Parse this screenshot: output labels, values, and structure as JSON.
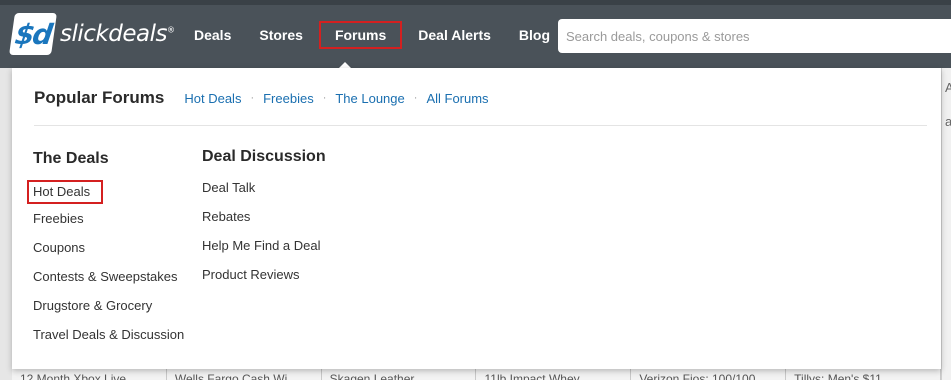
{
  "header": {
    "logo_mark": "$d",
    "logo_text": "slickdeals",
    "logo_reg": "®",
    "nav": [
      {
        "label": "Deals"
      },
      {
        "label": "Stores"
      },
      {
        "label": "Forums"
      },
      {
        "label": "Deal Alerts"
      },
      {
        "label": "Blog"
      }
    ],
    "search_placeholder": "Search deals, coupons & stores"
  },
  "dropdown": {
    "popular_title": "Popular Forums",
    "popular_links": [
      "Hot Deals",
      "Freebies",
      "The Lounge",
      "All Forums"
    ],
    "deals": {
      "title": "The Deals",
      "items": [
        "Hot Deals",
        "Freebies",
        "Coupons",
        "Contests & Sweepstakes",
        "Drugstore & Grocery",
        "Travel Deals & Discussion"
      ]
    },
    "discussion": {
      "title": "Deal Discussion",
      "items": [
        "Deal Talk",
        "Rebates",
        "Help Me Find a Deal",
        "Product Reviews"
      ]
    }
  },
  "background": {
    "cards": [
      "12 Month Xbox Live",
      "Wells Fargo Cash Wi",
      "Skagen Leather",
      "11lb Impact Whey",
      "Verizon Fios: 100/100",
      "Tillys: Men's $11"
    ],
    "right_glimpse": [
      "A",
      "a"
    ]
  },
  "colors": {
    "header_bg": "#4a5259",
    "link": "#1a6fb0",
    "highlight_box": "#d42020"
  }
}
